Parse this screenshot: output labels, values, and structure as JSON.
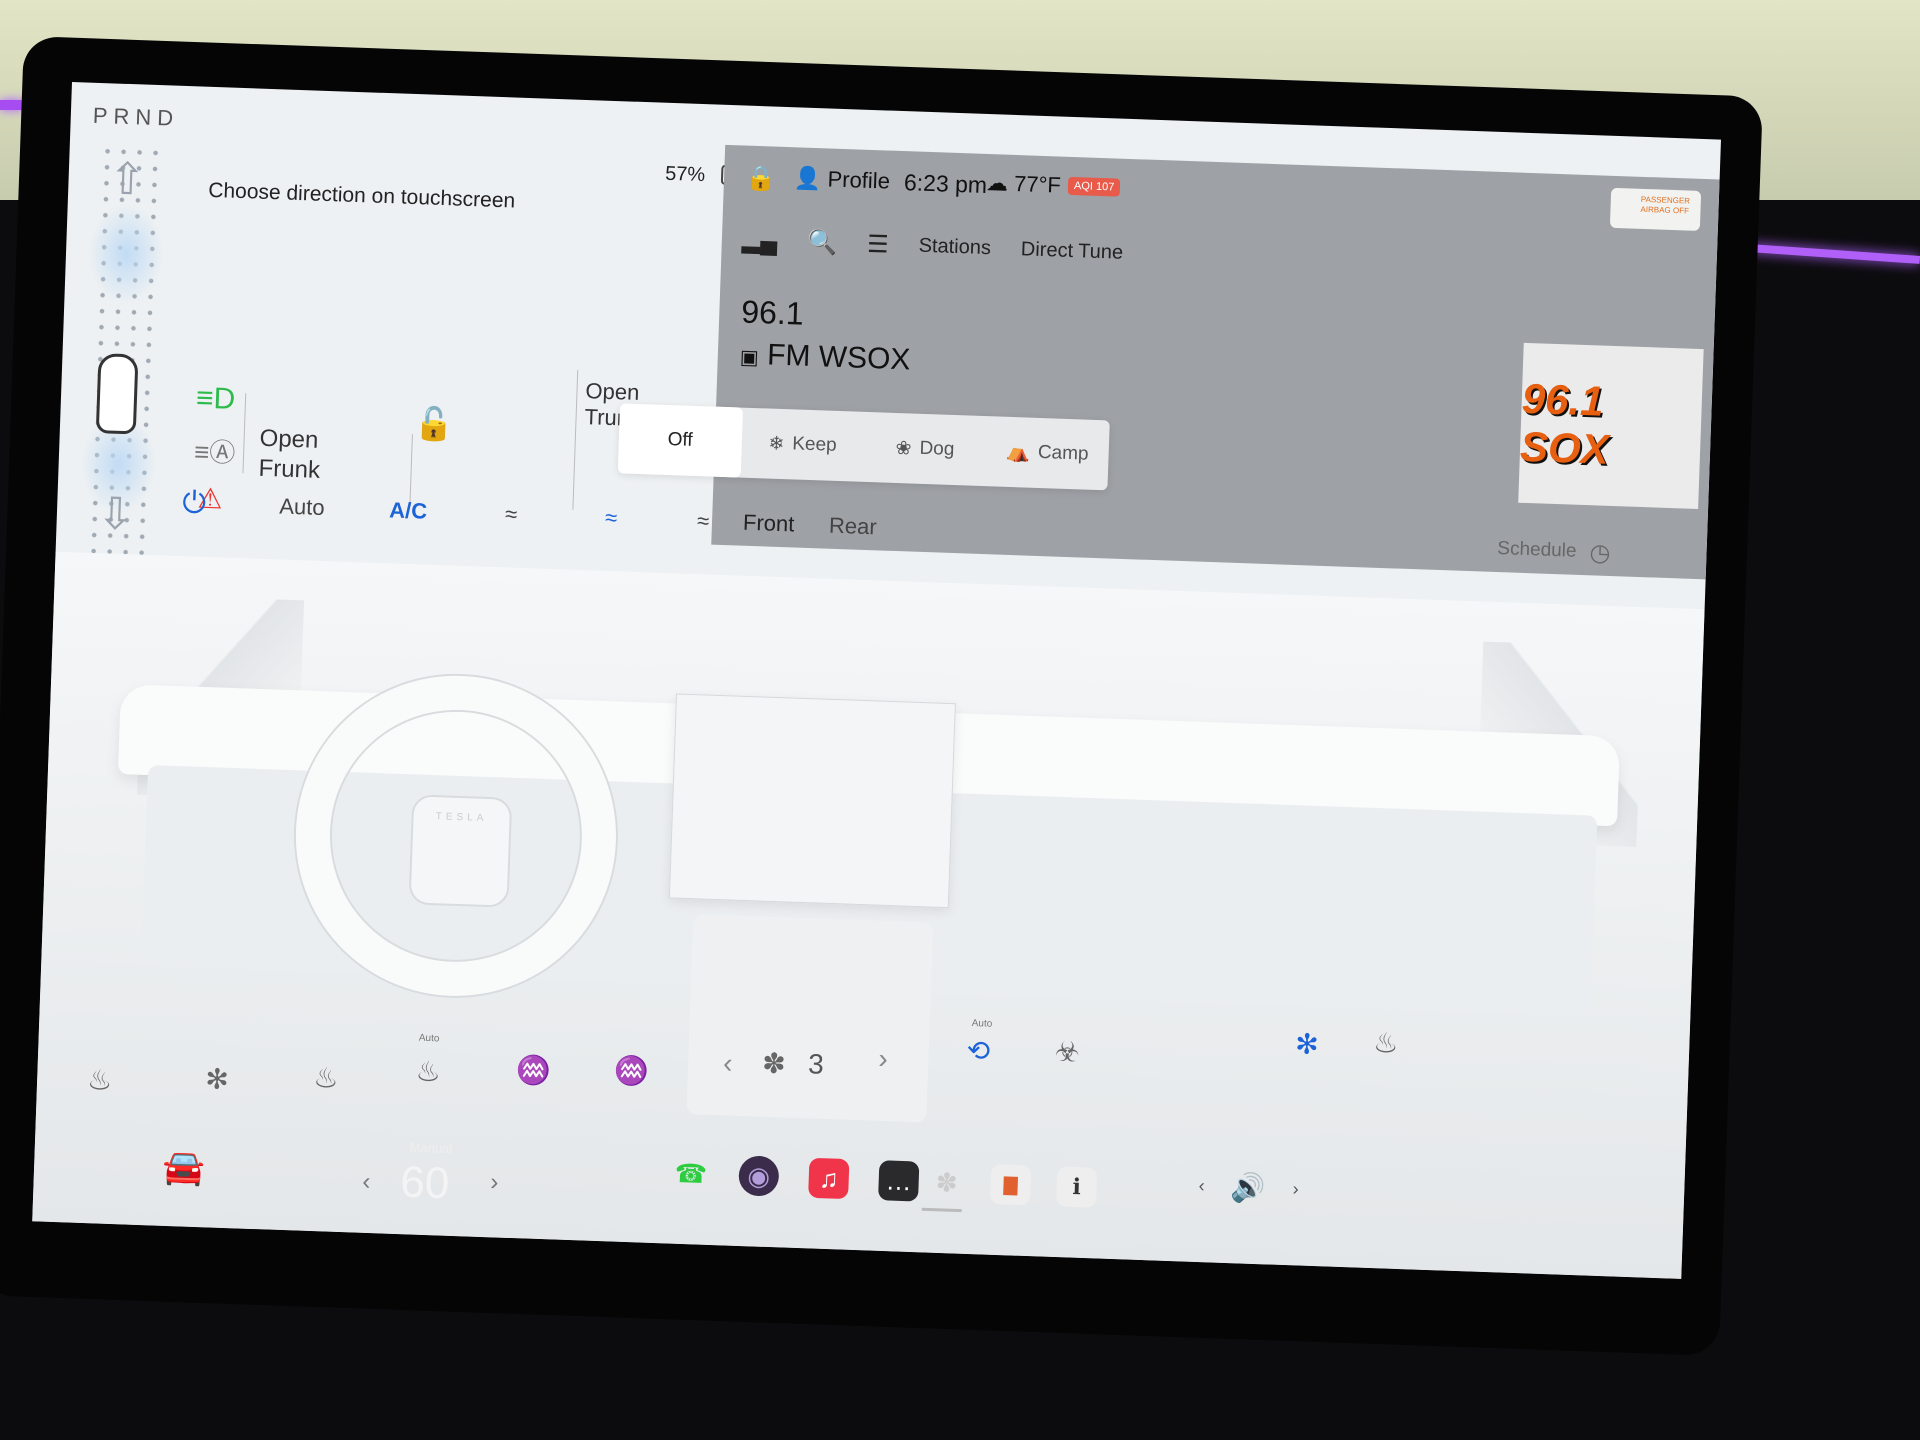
{
  "drive": {
    "gear_letters": "PRND",
    "hint": "Choose direction on touchscreen",
    "up_arrow": "arrow-up-icon",
    "down_arrow": "arrow-down-icon"
  },
  "status": {
    "battery_pct": "57%",
    "profile": "Profile",
    "time": "6:23 pm",
    "weather_temp": "77°F",
    "aqi": "AQI 107",
    "airbag_line1": "PASSENGER",
    "airbag_line2": "AIRBAG OFF"
  },
  "controls": {
    "frunk_line1": "Open",
    "frunk_line2": "Frunk",
    "trunk_line1": "Open",
    "trunk_line2": "Trunk"
  },
  "radio": {
    "toolbar": [
      "Stations",
      "Direct Tune"
    ],
    "frequency": "96.1",
    "station": "FM WSOX",
    "logo_text": "96.1 SOX"
  },
  "climate_modes": [
    {
      "label": "Off",
      "icon": ""
    },
    {
      "label": "Keep",
      "icon": "keep-icon"
    },
    {
      "label": "Dog",
      "icon": "paw-icon"
    },
    {
      "label": "Camp",
      "icon": "tent-icon"
    }
  ],
  "climate_bar": {
    "auto": "Auto",
    "ac": "A/C",
    "front": "Front",
    "rear": "Rear",
    "schedule": "Schedule"
  },
  "climate_bottom": {
    "auto_tag_left": "Auto",
    "auto_tag_right": "Auto",
    "fan_speed": "3"
  },
  "dock": {
    "temp_mode": "Manual",
    "temp_value": "60"
  },
  "colors": {
    "accent": "#1d63d8",
    "headlight_green": "#2dbb4b",
    "seatbelt_red": "#e33333",
    "radio_bg": "#9ea1a6"
  }
}
